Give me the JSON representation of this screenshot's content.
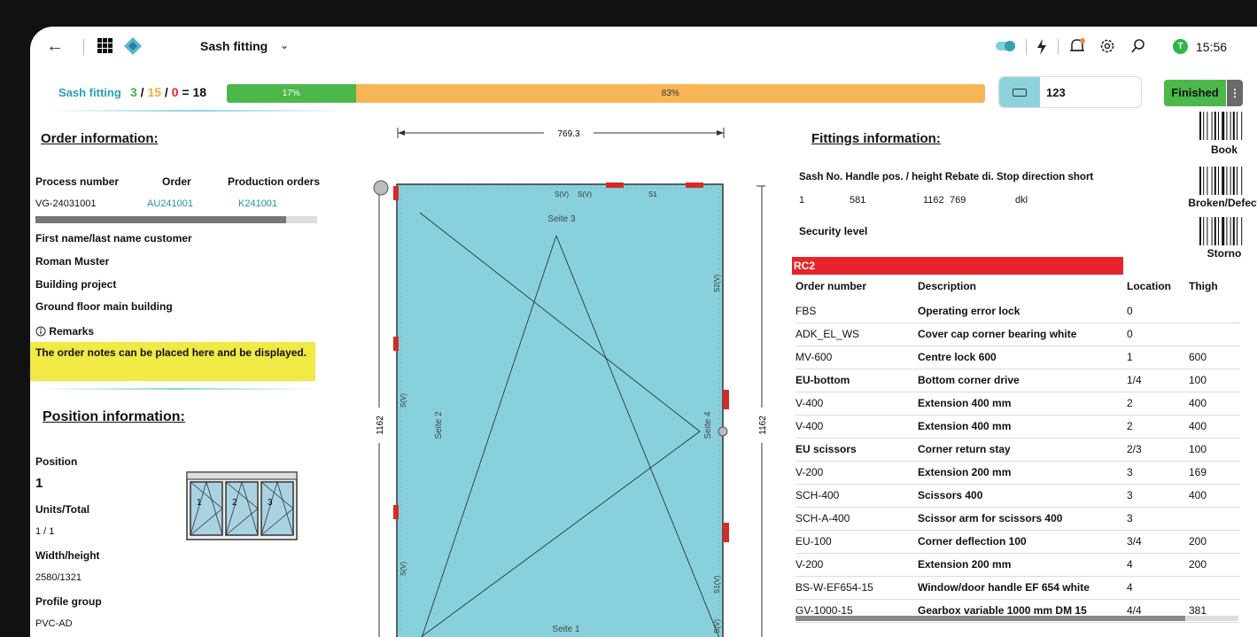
{
  "topbar": {
    "title": "Sash fitting",
    "time": "15:56",
    "user_initial": "T"
  },
  "progress": {
    "label": "Sash fitting",
    "done": "3",
    "open": "15",
    "failed": "0",
    "total": "18",
    "done_pct": "17%",
    "open_pct": "83%",
    "done_fraction": 0.17
  },
  "scan": {
    "value": "123"
  },
  "status_button": "Finished",
  "order": {
    "heading": "Order information:",
    "cols": [
      "Process number",
      "Order",
      "Production orders"
    ],
    "values": [
      "VG-24031001",
      "AU241001",
      "K241001"
    ],
    "customer_label": "First name/last name customer",
    "customer": "Roman Muster",
    "project_label": "Building project",
    "project": "Ground floor main building",
    "remarks_label": "Remarks",
    "remarks": "The order notes can be placed here and be displayed."
  },
  "position": {
    "heading": "Position information:",
    "position_label": "Position",
    "position": "1",
    "units_label": "Units/Total",
    "units": "1 / 1",
    "wh_label": "Width/height",
    "wh": "2580/1321",
    "profile_label": "Profile group",
    "profile": "PVC-AD",
    "thumb_numbers": [
      "1",
      "2",
      "3"
    ]
  },
  "drawing": {
    "width": "769.3",
    "height": "1162",
    "side_labels": [
      "Seite 1",
      "Seite 2",
      "Seite 3",
      "Seite 4"
    ],
    "markers": [
      "S(V)",
      "S(V)",
      "S1",
      "S2",
      "S2(V)",
      "S(V)",
      "S(V)",
      "S1(V)",
      "S(V)"
    ]
  },
  "fittings": {
    "heading": "Fittings information:",
    "sash_header": "Sash No. Handle pos. / height Rebate di. Stop direction short",
    "sash_values": [
      "1",
      "581",
      "1162",
      "769",
      "dkl"
    ],
    "security_label": "Security level",
    "security_value": "RC2",
    "columns": [
      "Order number",
      "Description",
      "Location",
      "Thigh"
    ],
    "rows": [
      [
        "FBS",
        "Operating error lock",
        "0",
        ""
      ],
      [
        "ADK_EL_WS",
        "Cover cap corner bearing white",
        "0",
        ""
      ],
      [
        "MV-600",
        "Centre lock 600",
        "1",
        "600"
      ],
      [
        "EU-bottom",
        "Bottom corner drive",
        "1/4",
        "100"
      ],
      [
        "V-400",
        "Extension 400 mm",
        "2",
        "400"
      ],
      [
        "V-400",
        "Extension 400 mm",
        "2",
        "400"
      ],
      [
        "EU scissors",
        "Corner return stay",
        "2/3",
        "100"
      ],
      [
        "V-200",
        "Extension 200 mm",
        "3",
        "169"
      ],
      [
        "SCH-400",
        "Scissors 400",
        "3",
        "400"
      ],
      [
        "SCH-A-400",
        "Scissor arm for scissors 400",
        "3",
        ""
      ],
      [
        "EU-100",
        "Corner deflection 100",
        "3/4",
        "200"
      ],
      [
        "V-200",
        "Extension 200 mm",
        "4",
        "200"
      ],
      [
        "BS-W-EF654-15",
        "Window/door handle EF 654 white",
        "4",
        ""
      ],
      [
        "GV-1000-15",
        "Gearbox variable 1000 mm DM 15",
        "4/4",
        "381"
      ]
    ]
  },
  "barcodes": [
    "Book",
    "Broken/Defect",
    "Storno"
  ],
  "icons": [
    "back-arrow-icon",
    "apps-grid-icon",
    "logo-icon",
    "chevron-down-icon",
    "toggle-icon",
    "flash-icon",
    "bell-icon",
    "gear-icon",
    "search-icon",
    "avatar-icon",
    "scanner-icon",
    "info-icon"
  ]
}
